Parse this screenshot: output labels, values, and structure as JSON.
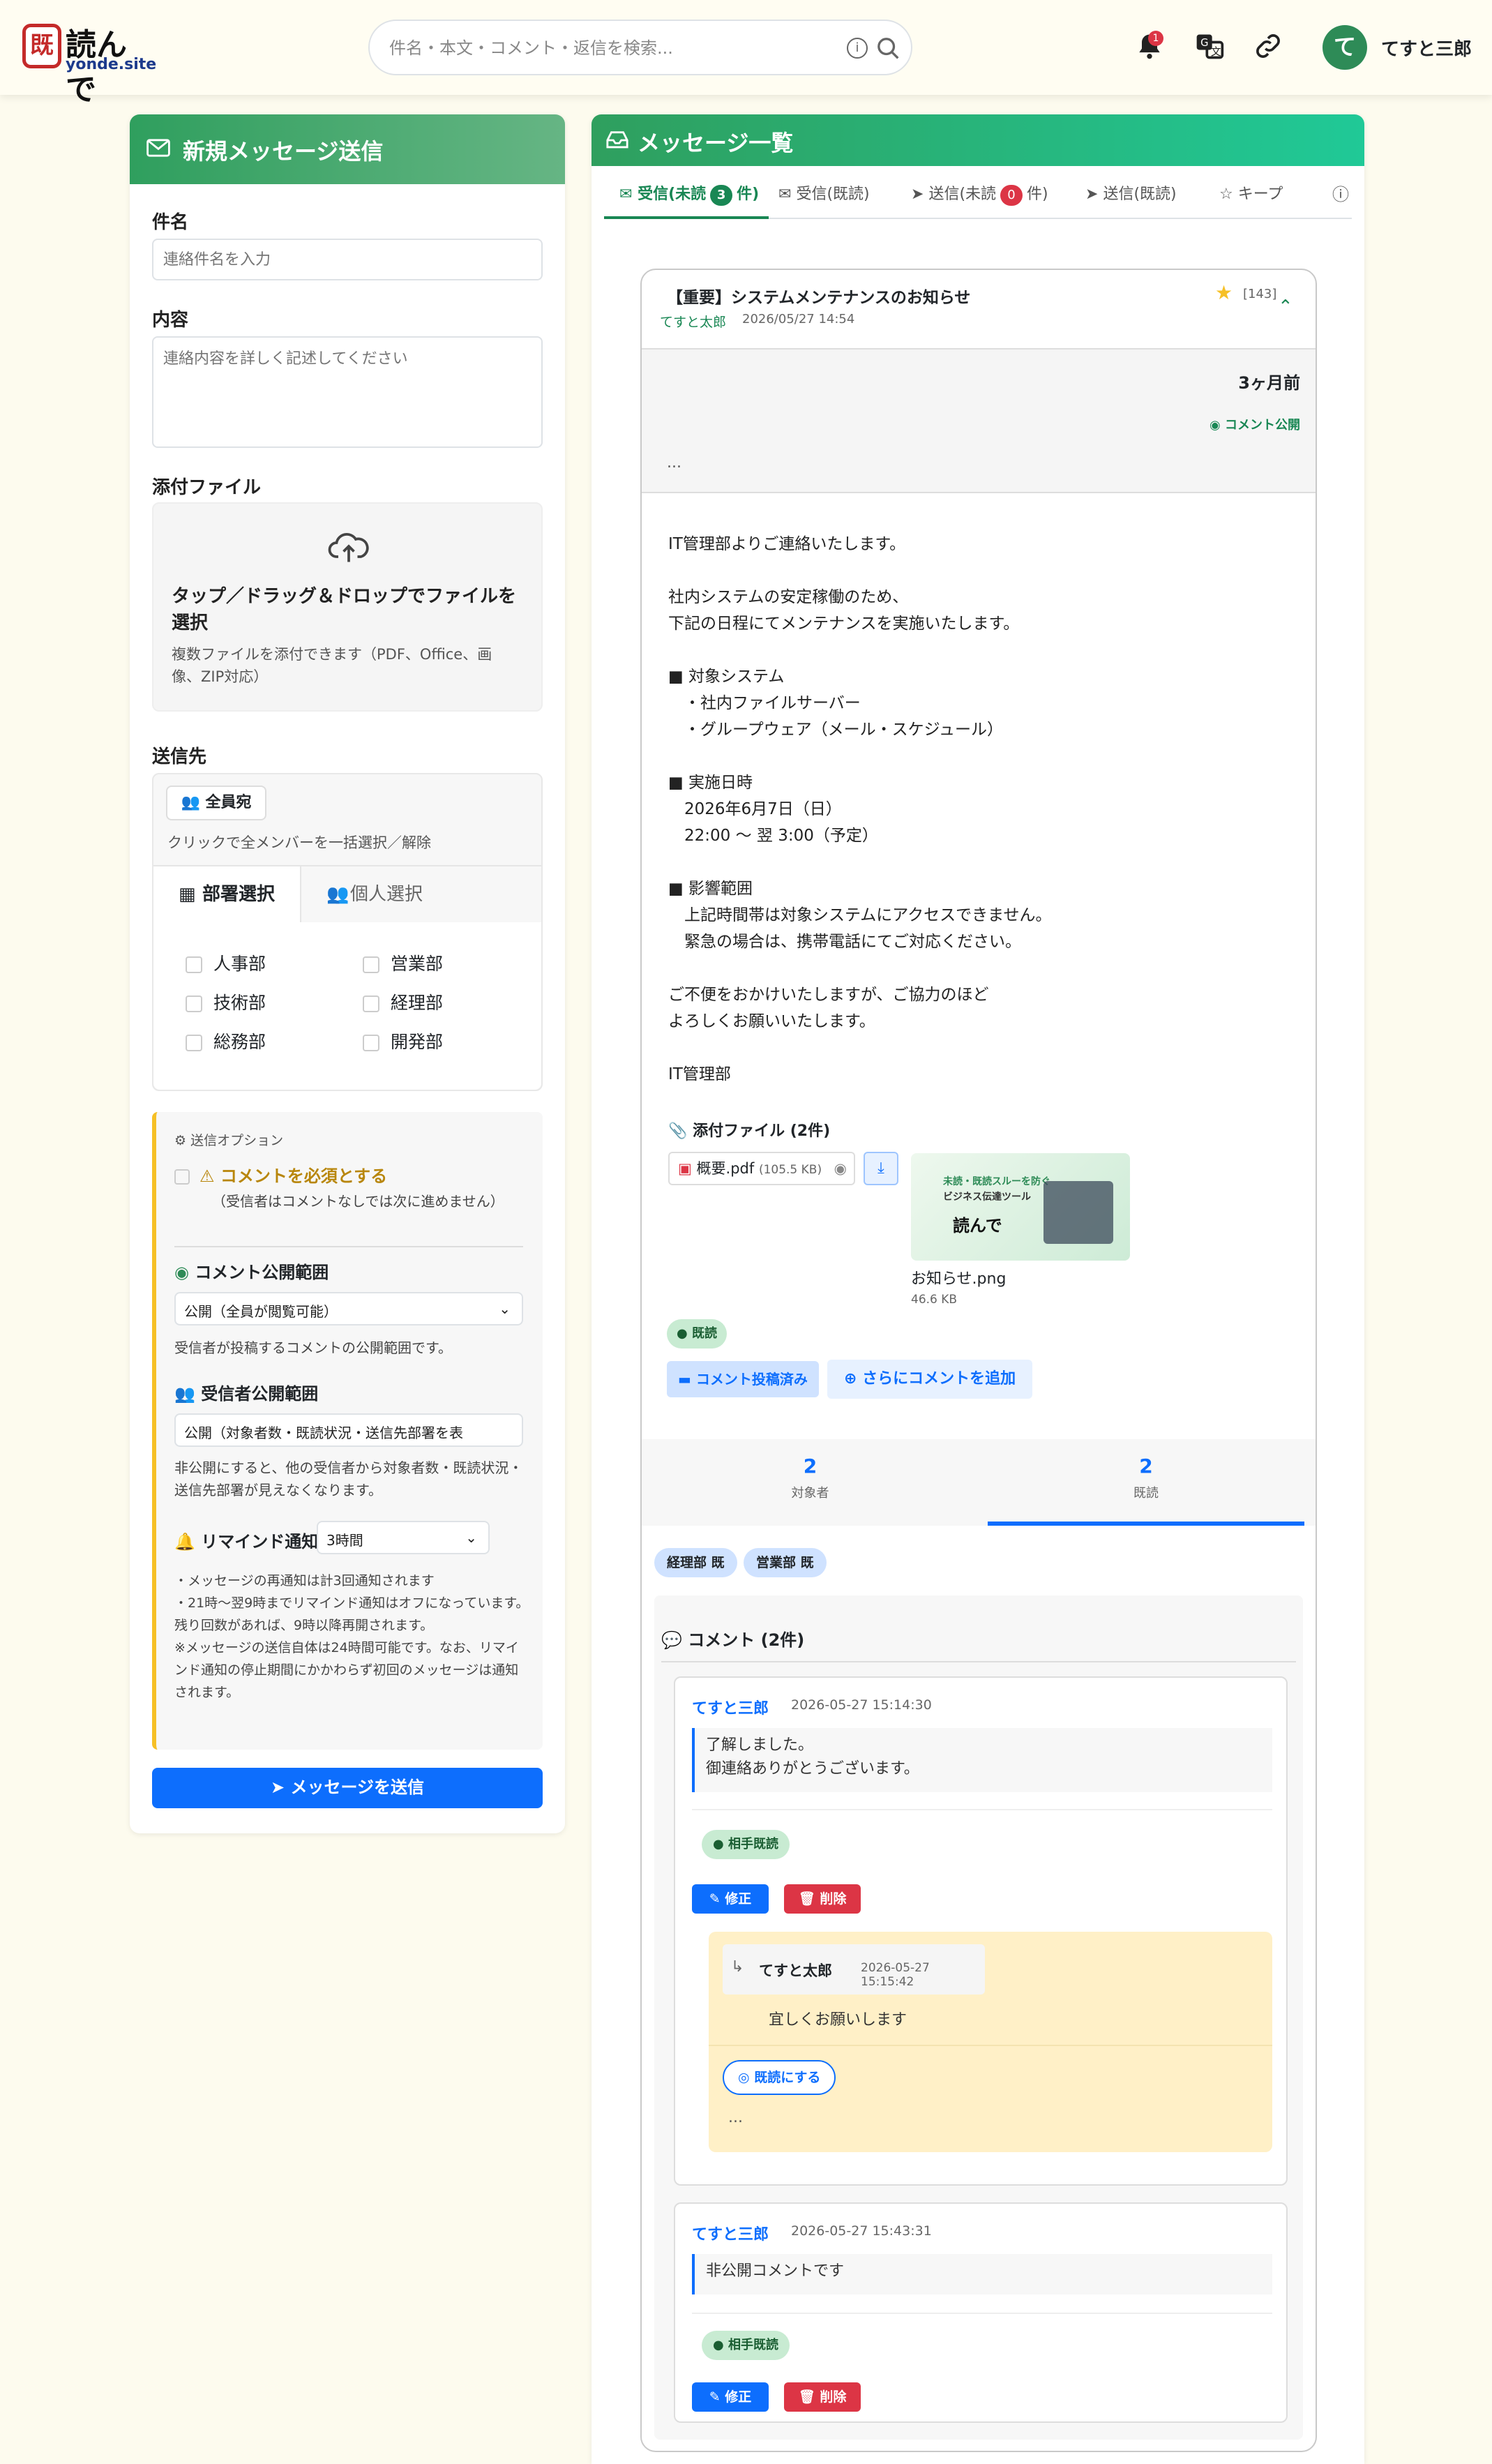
{
  "header": {
    "logo_kanji": "既",
    "logo_name": "読んで",
    "logo_site": "yonde.site",
    "search_placeholder": "件名・本文・コメント・返信を検索...",
    "notif_count": "1",
    "user_initial": "て",
    "user_name": "てすと三郎"
  },
  "compose": {
    "title": "新規メッセージ送信",
    "subject_label": "件名",
    "subject_placeholder": "連絡件名を入力",
    "content_label": "内容",
    "content_placeholder": "連絡内容を詳しく記述してください",
    "attach_label": "添付ファイル",
    "drop_title": "タップ／ドラッグ＆ドロップでファイルを選択",
    "drop_sub": "複数ファイルを添付できます（PDF、Office、画像、ZIP対応）",
    "recipients_label": "送信先",
    "all_button": "全員宛",
    "all_hint": "クリックで全メンバーを一括選択／解除",
    "tab_dept": "部署選択",
    "tab_person": "個人選択",
    "departments": [
      "人事部",
      "営業部",
      "技術部",
      "経理部",
      "総務部",
      "開発部"
    ],
    "options_title": "送信オプション",
    "require_comment": "コメントを必須とする",
    "require_note": "（受信者はコメントなしでは次に進めません）",
    "comment_scope_label": "コメント公開範囲",
    "comment_scope_value": "公開（全員が閲覧可能）",
    "comment_scope_note": "受信者が投稿するコメントの公開範囲です。",
    "recipient_scope_label": "受信者公開範囲",
    "recipient_scope_value": "公開（対象者数・既読状況・送信先部署を表",
    "recipient_scope_note": "非公開にすると、他の受信者から対象者数・既読状況・送信先部署が見えなくなります。",
    "remind_label": "リマインド通知",
    "remind_value": "3時間",
    "remind_notes": [
      "・メッセージの再通知は計3回通知されます",
      "・21時〜翌9時までリマインド通知はオフになっています。残り回数があれば、9時以降再開されます。",
      "※メッセージの送信自体は24時間可能です。なお、リマインド通知の停止期間にかかわらず初回のメッセージは通知されます。"
    ],
    "send_button": "メッセージを送信"
  },
  "list": {
    "title": "メッセージ一覧",
    "tabs": {
      "unread_in": "受信(未読",
      "unread_in_count": "3",
      "unread_in_suffix": "件)",
      "read_in": "受信(既読)",
      "unread_out": "送信(未読",
      "unread_out_count": "0",
      "unread_out_suffix": "件)",
      "read_out": "送信(既読)",
      "keep": "キープ"
    }
  },
  "message": {
    "subject": "【重要】システムメンテナンスのお知らせ",
    "sender": "てすと太郎",
    "date": "2026/05/27 14:54",
    "star_count": "[143]",
    "age": "3ヶ月前",
    "visibility": "コメント公開",
    "ellipsis": "...",
    "body": "IT管理部よりご連絡いたします。\n\n社内システムの安定稼働のため、\n下記の日程にてメンテナンスを実施いたします。\n\n■ 対象システム\n　・社内ファイルサーバー\n　・グループウェア（メール・スケジュール）\n\n■ 実施日時\n　2026年6月7日（日）\n　22:00 〜 翌 3:00（予定）\n\n■ 影響範囲\n　上記時間帯は対象システムにアクセスできません。\n　緊急の場合は、携帯電話にてご対応ください。\n\nご不便をおかけいたしますが、ご協力のほど\nよろしくお願いいたします。\n\nIT管理部",
    "attach_title": "添付ファイル (2件)",
    "pdf_name": "概要.pdf",
    "pdf_size": "(105.5 KB)",
    "thumb_line1": "未読・既読スルーを防ぐ",
    "thumb_line2": "ビジネス伝達ツール",
    "thumb_logo": "読んで",
    "img_name": "お知らせ.png",
    "img_size": "46.6 KB",
    "read_badge": "既読",
    "commented_button": "コメント投稿済み",
    "add_comment_button": "さらにコメントを追加",
    "stat_targets_num": "2",
    "stat_targets_label": "対象者",
    "stat_read_num": "2",
    "stat_read_label": "既読",
    "dept_tags": [
      "経理部 既",
      "営業部 既"
    ]
  },
  "comments": {
    "title": "コメント (2件)",
    "items": [
      {
        "author": "てすと三郎",
        "time": "2026-05-27 15:14:30",
        "text": "了解しました。\n御連絡ありがとうございます。",
        "badge": "相手既読",
        "edit": "修正",
        "delete": "削除",
        "reply": {
          "author": "てすと太郎",
          "time": "2026-05-27 15:15:42",
          "text": "宜しくお願いします",
          "mark_read": "既読にする",
          "ellipsis": "..."
        }
      },
      {
        "author": "てすと三郎",
        "time": "2026-05-27 15:43:31",
        "text": "非公開コメントです",
        "badge": "相手既読",
        "edit": "修正",
        "delete": "削除"
      }
    ]
  }
}
